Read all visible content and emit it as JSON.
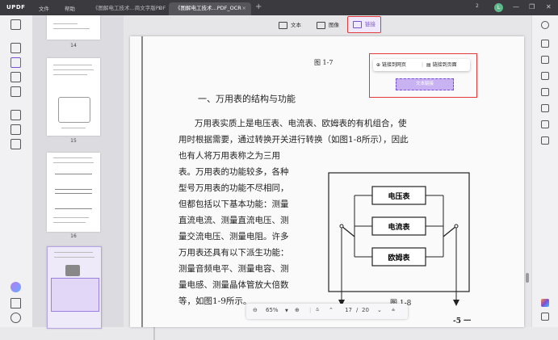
{
  "app": {
    "logo": "UPDF"
  },
  "menu": {
    "file": "文件",
    "help": "帮助"
  },
  "tabs": [
    {
      "label": "《图解电工技术...商文字版PDF",
      "close": "×"
    },
    {
      "label": "《图解电工技术...PDF_OCR",
      "close": "×"
    }
  ],
  "titlebar": {
    "new_tab": "+",
    "badge": "2",
    "avatar": "L"
  },
  "thumbnails": {
    "pages": [
      "14",
      "15",
      "16"
    ]
  },
  "toolbar": {
    "text_label": "文本",
    "image_label": "图像",
    "link_label": "链接"
  },
  "link_popup": {
    "to_web": "链接到网页",
    "to_page": "链接到页面",
    "area_label": "文本链接"
  },
  "document": {
    "fig_top": "图 1-7",
    "heading": "一、万用表的结构与功能",
    "lines": [
      "万用表实质上是电压表、电流表、欧姆表的有机组合，使",
      "用时根据需要，通过转换开关进行转换（如图1-8所示），因此",
      "也有人将万用表称之为三用",
      "表。万用表的功能较多，各种",
      "型号万用表的功能不尽相同，",
      "但都包括以下基本功能：测量",
      "直流电流、测量直流电压、测",
      "量交流电压、测量电阻。许多",
      "万用表还具有以下派生功能：",
      "测量音频电平、测量电容、测",
      "量电感、测量晶体管放大倍数",
      "等，如图1-9所示。"
    ],
    "diagram": {
      "box1": "电压表",
      "box2": "电流表",
      "box3": "欧姆表"
    },
    "fig_caption": "图 1-8",
    "page_number": "-5 一"
  },
  "navbar": {
    "zoom": "65%",
    "current_page": "17",
    "total_pages": "20",
    "separator": "/"
  },
  "colors": {
    "accent": "#7a4fd8",
    "highlight_border": "#e03a3a"
  }
}
